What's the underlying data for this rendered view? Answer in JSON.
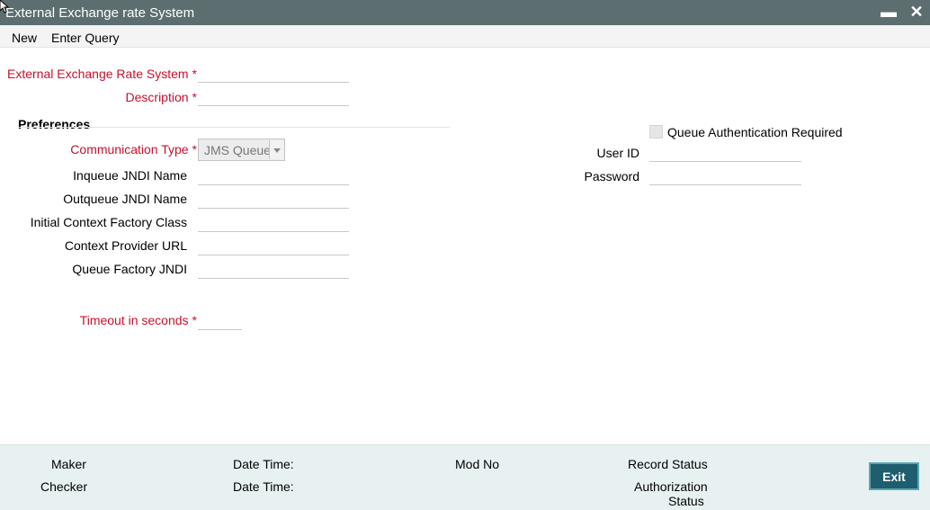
{
  "window": {
    "title": "External Exchange rate System",
    "minimize_glyph": "▬",
    "close_glyph": "✕"
  },
  "menu": {
    "new": "New",
    "enter_query": "Enter Query"
  },
  "form": {
    "ext_system_label": "External Exchange Rate System",
    "description_label": "Description",
    "required_marker": "*",
    "preferences_title": "Preferences",
    "communication_type_label": "Communication Type",
    "communication_type_value": "JMS Queue",
    "inqueue_label": "Inqueue JNDI Name",
    "outqueue_label": "Outqueue JNDI Name",
    "initial_context_label": "Initial Context Factory Class",
    "context_provider_label": "Context Provider URL",
    "queue_factory_label": "Queue Factory JNDI",
    "timeout_label": "Timeout in seconds",
    "queue_auth_label": "Queue Authentication Required",
    "user_id_label": "User ID",
    "password_label": "Password"
  },
  "footer": {
    "maker": "Maker",
    "checker": "Checker",
    "date_time_1": "Date Time:",
    "date_time_2": "Date Time:",
    "mod_no": "Mod No",
    "record_status": "Record Status",
    "authorization_line1": "Authorization",
    "authorization_line2": "Status",
    "exit": "Exit"
  },
  "colors": {
    "titlebar": "#5c6e70",
    "required_text": "#c8102e",
    "footer_bg": "#e8f1f1",
    "exit_button": "#1e5e6e"
  }
}
